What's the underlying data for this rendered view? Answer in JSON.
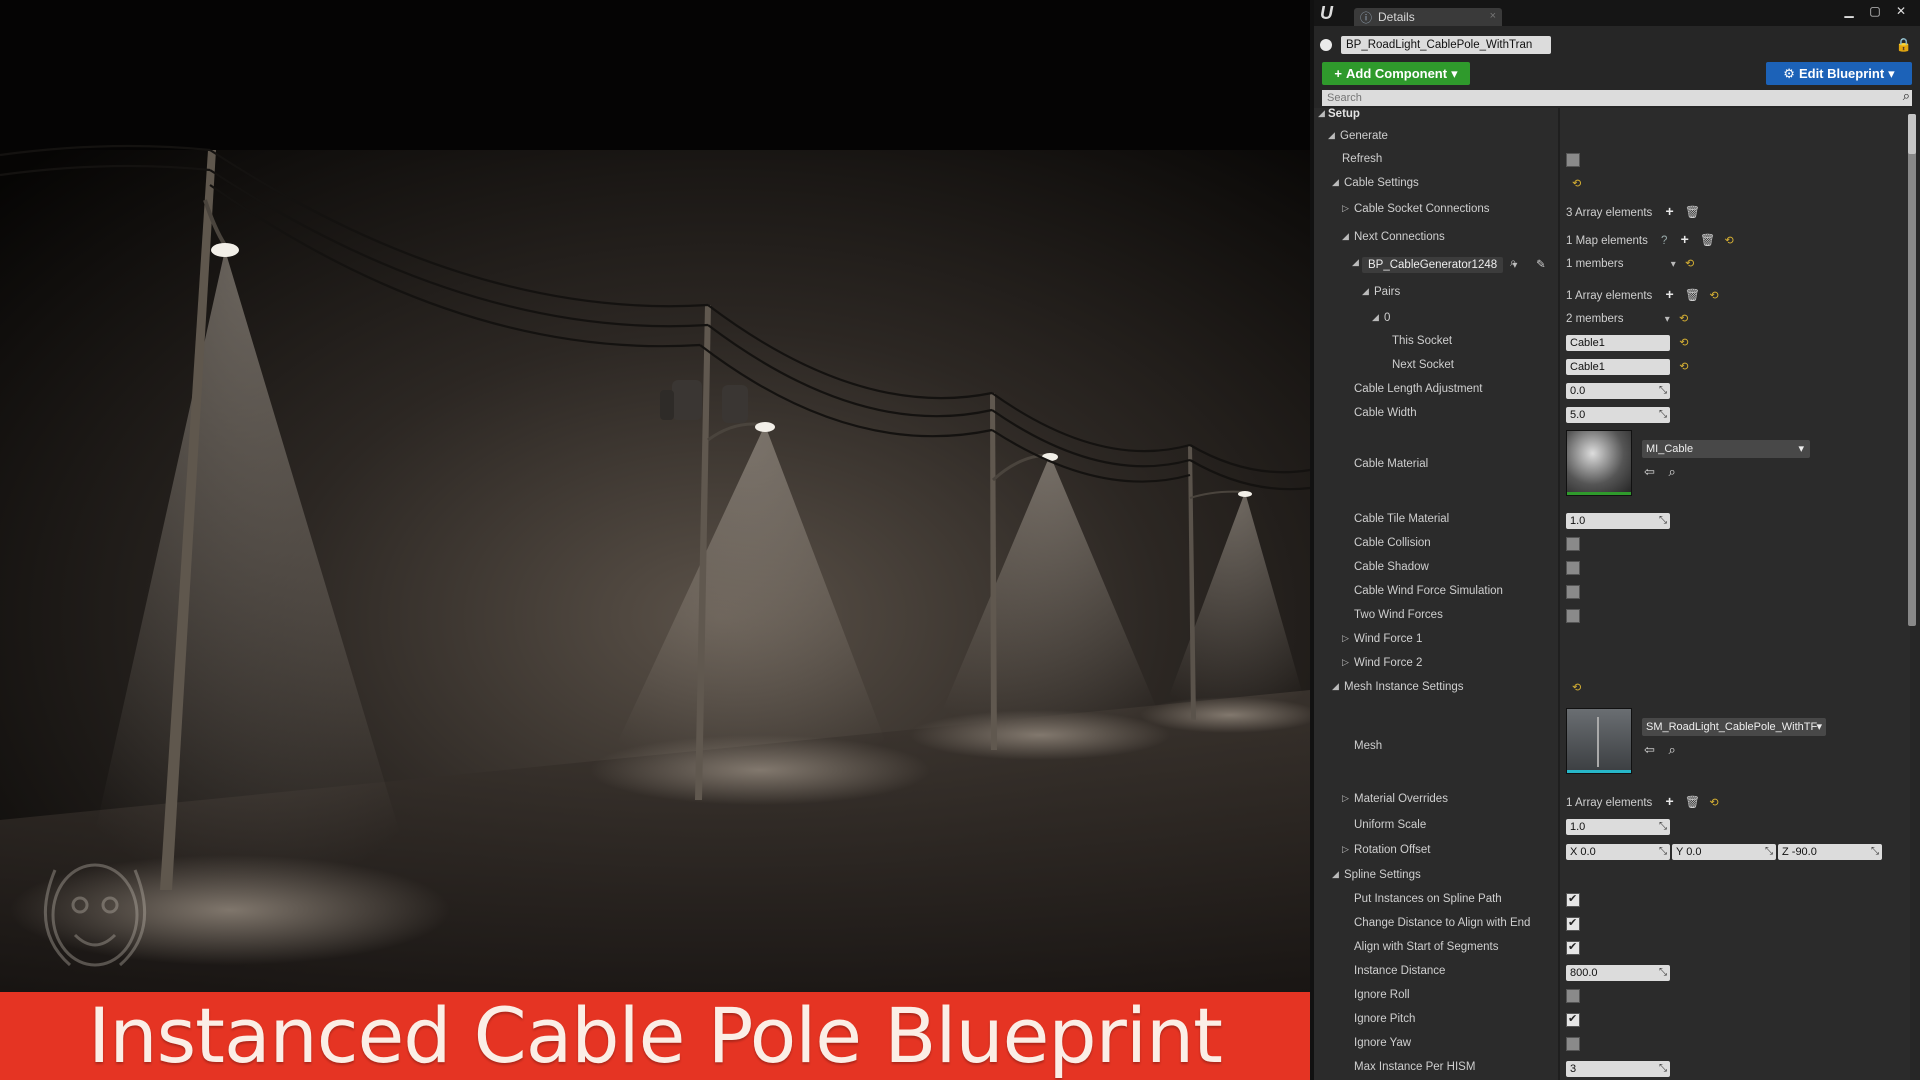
{
  "banner": {
    "text": "Instanced Cable Pole Blueprint"
  },
  "window": {
    "tab_label": "Details",
    "tab_close": "×",
    "logo": "U",
    "min": "▁",
    "max": "▢",
    "close": "✕"
  },
  "object": {
    "name": "BP_RoadLight_CablePole_WithTran"
  },
  "toolbar": {
    "add_component": "Add Component",
    "edit_blueprint": "Edit Blueprint"
  },
  "search": {
    "placeholder": "Search"
  },
  "props": {
    "setup": "Setup",
    "generate": "Generate",
    "refresh": "Refresh",
    "cable_settings": "Cable Settings",
    "cable_socket_connections": "Cable Socket Connections",
    "cable_socket_connections_val": "3 Array elements",
    "next_connections": "Next Connections",
    "next_connections_val": "1 Map elements",
    "generator_key": "BP_CableGenerator1248",
    "generator_members": "1 members",
    "pairs": "Pairs",
    "pairs_val": "1 Array elements",
    "index0": "0",
    "index0_val": "2 members",
    "this_socket": "This Socket",
    "this_socket_val": "Cable1",
    "next_socket": "Next Socket",
    "next_socket_val": "Cable1",
    "cable_length_adjustment": "Cable Length Adjustment",
    "cable_length_adjustment_val": "0.0",
    "cable_width": "Cable Width",
    "cable_width_val": "5.0",
    "cable_material": "Cable Material",
    "cable_material_val": "MI_Cable",
    "cable_tile_material": "Cable Tile Material",
    "cable_tile_material_val": "1.0",
    "cable_collision": "Cable Collision",
    "cable_shadow": "Cable Shadow",
    "cable_wind_force_simulation": "Cable Wind Force Simulation",
    "two_wind_forces": "Two Wind Forces",
    "wind_force_1": "Wind Force 1",
    "wind_force_2": "Wind Force 2",
    "mesh_instance_settings": "Mesh Instance Settings",
    "mesh": "Mesh",
    "mesh_val": "SM_RoadLight_CablePole_WithTF",
    "material_overrides": "Material Overrides",
    "material_overrides_val": "1 Array elements",
    "uniform_scale": "Uniform Scale",
    "uniform_scale_val": "1.0",
    "rotation_offset": "Rotation Offset",
    "rot_x": "X  0.0",
    "rot_y": "Y  0.0",
    "rot_z": "Z  -90.0",
    "spline_settings": "Spline Settings",
    "put_instances_on_spline_path": "Put Instances on Spline Path",
    "change_distance_to_align_with_end": "Change Distance to Align with End",
    "align_with_start_of_segments": "Align with Start of Segments",
    "instance_distance": "Instance Distance",
    "instance_distance_val": "800.0",
    "ignore_roll": "Ignore Roll",
    "ignore_pitch": "Ignore Pitch",
    "ignore_yaw": "Ignore Yaw",
    "max_instance_per_hism": "Max Instance Per HISM",
    "max_instance_per_hism_val": "3"
  },
  "checkbox_states": {
    "refresh": false,
    "cable_collision": false,
    "cable_shadow": false,
    "cable_wind_force_simulation": false,
    "two_wind_forces": false,
    "put_instances_on_spline_path": true,
    "change_distance_to_align_with_end": true,
    "align_with_start_of_segments": true,
    "ignore_roll": false,
    "ignore_pitch": true,
    "ignore_yaw": false
  },
  "colors": {
    "banner_red": "#e53423",
    "add_component_green": "#2f9a2c",
    "edit_blueprint_blue": "#1c62b8",
    "panel_bg": "#2b2b2b",
    "reset_yellow": "#d9b233"
  },
  "icons": {
    "plus": "+",
    "trash": "🗑",
    "reset": "⟲",
    "dropdown": "▾",
    "spin": "⤡",
    "search": "⌕",
    "browse": "⌕",
    "use_selected": "⇦",
    "picker": "✎",
    "help": "?",
    "lock": "🔒",
    "gear": "⚙"
  }
}
